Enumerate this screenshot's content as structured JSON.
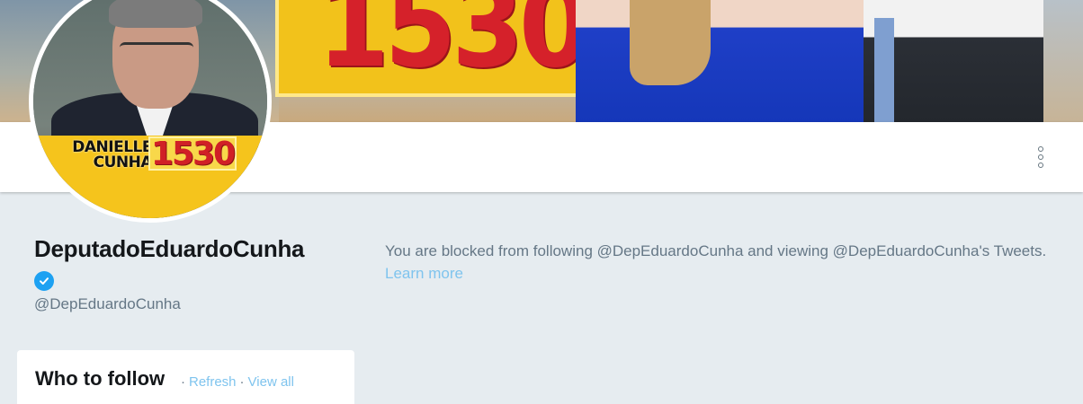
{
  "banner": {
    "number": "1530"
  },
  "avatar": {
    "name_line1": "DANIELLE",
    "name_line2": "CUNHA",
    "number": "1530"
  },
  "profile": {
    "name": "DeputadoEduardoCunha",
    "screen_name": "@DepEduardoCunha",
    "verified": true
  },
  "blocked": {
    "message": "You are blocked from following @DepEduardoCunha and viewing @DepEduardoCunha's Tweets.",
    "learn_more": "Learn more"
  },
  "who_to_follow": {
    "title": "Who to follow",
    "separator": "·",
    "refresh_label": "Refresh",
    "view_all_label": "View all"
  },
  "colors": {
    "link": "#7fc4ee",
    "verified": "#1da1f2",
    "background": "#e6ecf0"
  },
  "icons": [
    "more-vertical-icon",
    "verified-badge-icon"
  ]
}
